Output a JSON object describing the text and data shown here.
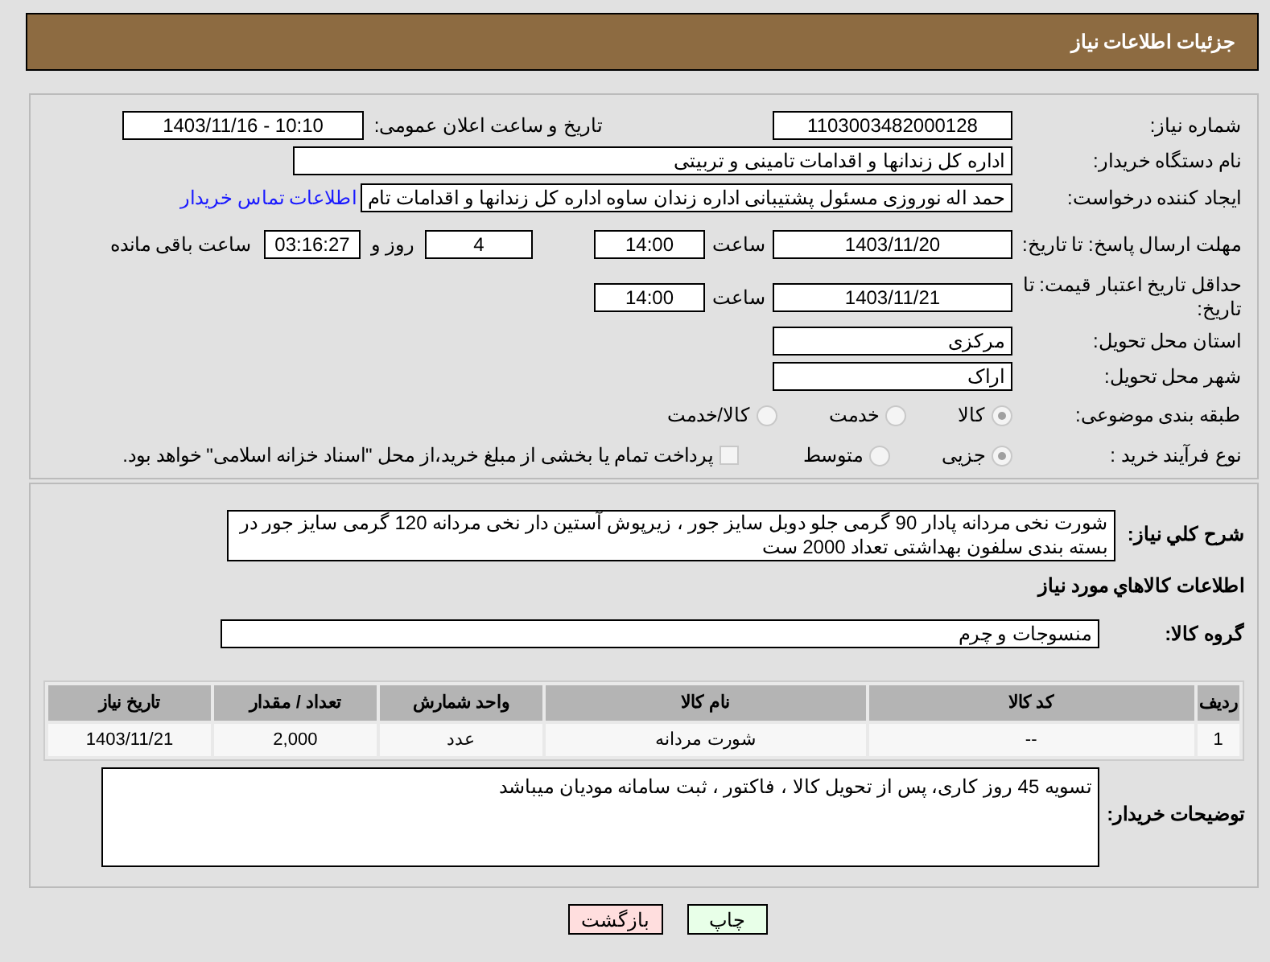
{
  "header": {
    "title": "جزئیات اطلاعات نیاز"
  },
  "need_number": {
    "label": "شماره نیاز:",
    "value": "1103003482000128"
  },
  "announce": {
    "label": "تاریخ و ساعت اعلان عمومی:",
    "value": "1403/11/16 - 10:10"
  },
  "buyer_org": {
    "label": "نام دستگاه خریدار:",
    "value": "اداره کل زندانها و اقدامات تامینی و تربیتی"
  },
  "requester": {
    "label": "ایجاد کننده درخواست:",
    "value": "حمد اله نوروزی مسئول پشتیبانی اداره زندان ساوه اداره کل زندانها و اقدامات تام",
    "link": "اطلاعات تماس خریدار"
  },
  "deadline": {
    "label": "مهلت ارسال پاسخ: تا تاریخ:",
    "date": "1403/11/20",
    "time_label": "ساعت",
    "time": "14:00",
    "days": "4",
    "days_label": "روز و",
    "remaining": "03:16:27",
    "remaining_label": "ساعت باقی مانده"
  },
  "validity": {
    "label": "حداقل تاریخ اعتبار قیمت: تا تاریخ:",
    "date": "1403/11/21",
    "time_label": "ساعت",
    "time": "14:00"
  },
  "province": {
    "label": "استان محل تحویل:",
    "value": "مرکزی"
  },
  "city": {
    "label": "شهر محل تحویل:",
    "value": "اراک"
  },
  "category": {
    "label": "طبقه بندی موضوعی:",
    "options": [
      {
        "label": "کالا",
        "selected": true
      },
      {
        "label": "خدمت",
        "selected": false
      },
      {
        "label": "کالا/خدمت",
        "selected": false
      }
    ]
  },
  "purchase_type": {
    "label": "نوع فرآیند خرید :",
    "options": [
      {
        "label": "جزیی",
        "selected": true
      },
      {
        "label": "متوسط",
        "selected": false
      }
    ],
    "checkbox": {
      "label": "پرداخت تمام یا بخشی از مبلغ خرید،از محل \"اسناد خزانه اسلامی\" خواهد بود.",
      "checked": false
    }
  },
  "description": {
    "label": "شرح کلي نياز:",
    "value": "شورت  نخی مردانه پادار 90 گرمی جلو دوبل سایز جور ، زیرپوش آستین دار  نخی مردانه 120 گرمی سایز جور در بسته بندی سلفون بهداشتی تعداد 2000 ست"
  },
  "goods_title": "اطلاعات كالاهاي مورد نياز",
  "goods_group": {
    "label": "گروه کالا:",
    "value": "منسوجات و چرم"
  },
  "table": {
    "columns": [
      "ردیف",
      "کد کالا",
      "نام کالا",
      "واحد شمارش",
      "تعداد / مقدار",
      "تاریخ نیاز"
    ],
    "rows": [
      [
        "1",
        "--",
        "شورت مردانه",
        "عدد",
        "2,000",
        "1403/11/21"
      ]
    ]
  },
  "buyer_notes": {
    "label": "توضیحات خریدار:",
    "value": "تسویه 45 روز کاری، پس از تحویل کالا ، فاکتور ، ثبت سامانه مودیان میباشد"
  },
  "buttons": [
    {
      "label": "چاپ",
      "kind": "print"
    },
    {
      "label": "بازگشت",
      "kind": "back"
    }
  ]
}
